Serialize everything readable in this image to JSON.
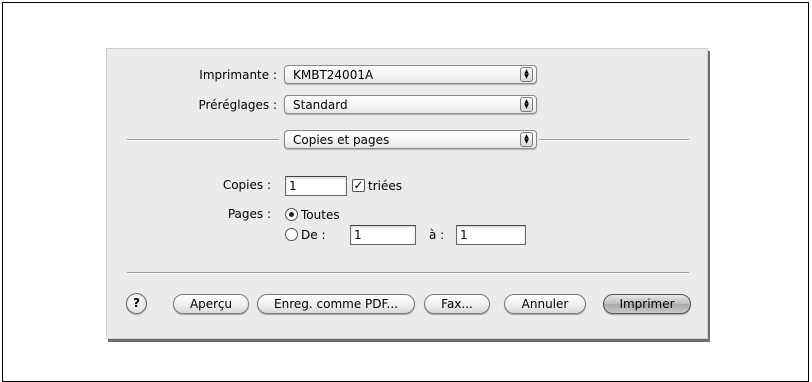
{
  "printer": {
    "label": "Imprimante :",
    "value": "KMBT24001A"
  },
  "presets": {
    "label": "Préréglages :",
    "value": "Standard"
  },
  "pane": {
    "value": "Copies et pages"
  },
  "copies": {
    "label": "Copies :",
    "value": "1",
    "collated_label": "triées",
    "collated": true
  },
  "pages": {
    "label": "Pages :",
    "all_label": "Toutes",
    "from_label": "De :",
    "from_value": "1",
    "to_label": "à :",
    "to_value": "1",
    "selected": "all"
  },
  "buttons": {
    "help": "?",
    "preview": "Aperçu",
    "save_pdf": "Enreg. comme PDF...",
    "fax": "Fax...",
    "cancel": "Annuler",
    "print": "Imprimer"
  },
  "icons": {
    "popup_arrows": "up-down-arrows-icon",
    "check": "checkmark-icon",
    "help": "question-mark-icon"
  }
}
